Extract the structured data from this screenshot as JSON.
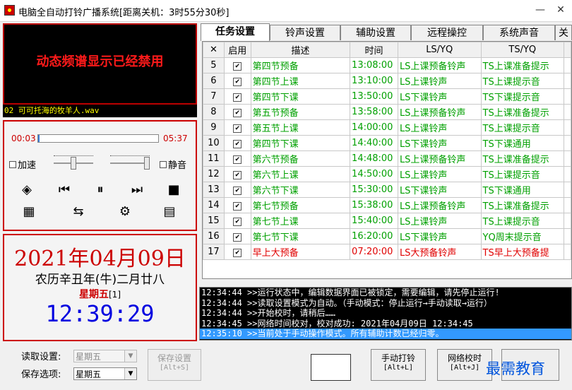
{
  "window": {
    "title": "电脑全自动打铃广播系统[距离关机：3时55分30秒]",
    "minimize": "—",
    "close": "✕"
  },
  "spectrum": {
    "message": "动态频谱显示已经禁用"
  },
  "now_playing": "02 可可托海的牧羊人.wav",
  "player": {
    "time_current": "00:03",
    "time_total": "05:37",
    "progress_fraction": 0.01,
    "speed_label": "加速",
    "mute_label": "静音",
    "icons": [
      "loop-icon",
      "prev-icon",
      "pause-icon",
      "next-icon",
      "stop-icon",
      "qr-icon",
      "swap-icon",
      "gear-icon",
      "list-icon"
    ]
  },
  "date": {
    "main": "2021年04月09日",
    "lunar": "农历辛丑年(牛)二月廿八",
    "weekday": "星期五",
    "weekday_index": "[1]",
    "clock": "12:39:29"
  },
  "tabs": [
    "任务设置",
    "铃声设置",
    "辅助设置",
    "远程操控",
    "系统声音",
    "关"
  ],
  "table": {
    "headers": [
      "✕",
      "启用",
      "描述",
      "时间",
      "LS/YQ",
      "TS/YQ",
      ""
    ],
    "rows": [
      [
        "5",
        "第四节预备",
        "13:08:00",
        "LS上课预备铃声",
        "TS上课准备提示",
        "g"
      ],
      [
        "6",
        "第四节上课",
        "13:10:00",
        "LS上课铃声",
        "TS上课提示音",
        "g"
      ],
      [
        "7",
        "第四节下课",
        "13:50:00",
        "LS下课铃声",
        "TS下课提示音",
        "g"
      ],
      [
        "8",
        "第五节预备",
        "13:58:00",
        "LS上课预备铃声",
        "TS上课准备提示",
        "g"
      ],
      [
        "9",
        "第五节上课",
        "14:00:00",
        "LS上课铃声",
        "TS上课提示音",
        "g"
      ],
      [
        "10",
        "第四节下课",
        "14:40:00",
        "LS下课铃声",
        "TS下课通用",
        "g"
      ],
      [
        "11",
        "第六节预备",
        "14:48:00",
        "LS上课预备铃声",
        "TS上课准备提示",
        "g"
      ],
      [
        "12",
        "第六节上课",
        "14:50:00",
        "LS上课铃声",
        "TS上课提示音",
        "g"
      ],
      [
        "13",
        "第六节下课",
        "15:30:00",
        "LS下课铃声",
        "TS下课通用",
        "g"
      ],
      [
        "14",
        "第七节预备",
        "15:38:00",
        "LS上课预备铃声",
        "TS上课准备提示",
        "g"
      ],
      [
        "15",
        "第七节上课",
        "15:40:00",
        "LS上课铃声",
        "TS上课提示音",
        "g"
      ],
      [
        "16",
        "第七节下课",
        "16:20:00",
        "LS下课铃声",
        "YQ周末提示音",
        "g"
      ],
      [
        "17",
        "早上大预备",
        "07:20:00",
        "LS大预备铃声",
        "TS早上大预备提",
        "r"
      ]
    ]
  },
  "log": [
    "12:34:44 >>运行状态中，编辑数据界面已被锁定，需要编辑，请先停止运行!",
    "12:34:44 >>读取设置模式为自动。（手动模式：停止运行→手动读取→运行）",
    "12:34:44 >>开始校时，请稍后……",
    "12:34:45 >>网络时间校对，校对成功: 2021年04月09日 12:34:45",
    "12:35:10 >>当前处于手动操作模式。所有辅助计数已经归零。"
  ],
  "bottom": {
    "read_label": "读取设置:",
    "read_value": "星期五",
    "save_label": "保存选项:",
    "save_value": "星期五",
    "save_button": "保存设置",
    "save_button_key": "[Alt+S]",
    "ring_button": "手动打铃",
    "ring_button_key": "[Alt+L]",
    "sync_button": "网络校时",
    "sync_button_key": "[Alt+J]",
    "watermark": "最需教育"
  },
  "colors": {
    "green_text": "#00a000",
    "red_text": "#e00000",
    "accent_red": "#cc0000",
    "clock_blue": "#0000e0",
    "log_highlight": "#3399ff"
  }
}
